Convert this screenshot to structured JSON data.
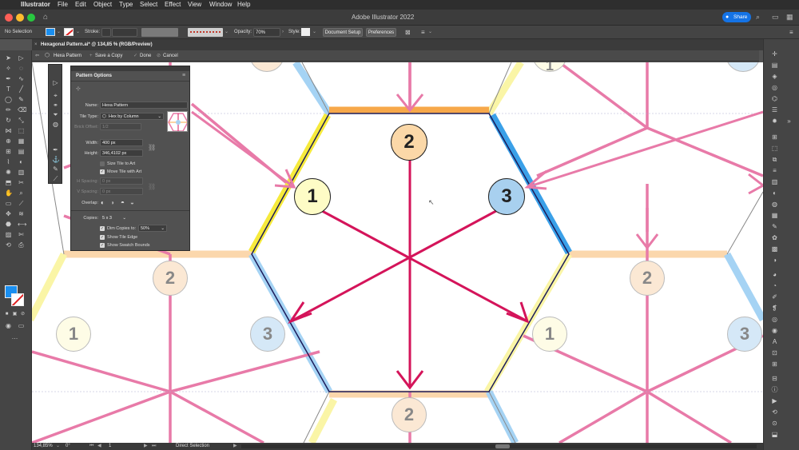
{
  "menubar": {
    "app": "Illustrator",
    "items": [
      "File",
      "Edit",
      "Object",
      "Type",
      "Select",
      "Effect",
      "View",
      "Window",
      "Help"
    ],
    "clock": ""
  },
  "titlebar": {
    "title": "Adobe Illustrator 2022",
    "share_label": "Share"
  },
  "control": {
    "selection": "No Selection",
    "stroke_label": "Stroke:",
    "opacity_label": "Opacity:",
    "opacity_value": "70%",
    "style_label": "Style:",
    "doc_setup": "Document Setup",
    "preferences": "Preferences"
  },
  "doctab": {
    "title": "Hexagonal Pattern.ai* @ 134,85 % (RGB/Preview)"
  },
  "patternbar": {
    "name": "Hexa Pattern",
    "save_copy": "Save a Copy",
    "done": "Done",
    "cancel": "Cancel"
  },
  "panel": {
    "title": "Pattern Options",
    "name_label": "Name:",
    "name_value": "Hexa Pattern",
    "tile_type_label": "Tile Type:",
    "tile_type_value": "Hex by Column",
    "brick_offset_label": "Brick Offset:",
    "brick_offset_value": "1/2",
    "width_label": "Width:",
    "width_value": "400 px",
    "height_label": "Height:",
    "height_value": "346,4102 px",
    "size_tile": "Size Tile to Art",
    "move_tile": "Move Tile with Art",
    "hspacing_label": "H Spacing:",
    "hspacing_value": "0 px",
    "vspacing_label": "V Spacing:",
    "vspacing_value": "0 px",
    "overlap_label": "Overlap:",
    "copies_label": "Copies:",
    "copies_value": "5 x 3",
    "dim_copies": "Dim Copies to:",
    "dim_value": "50%",
    "show_tile_edge": "Show Tile Edge",
    "show_swatch_bounds": "Show Swatch Bounds"
  },
  "status": {
    "zoom": "134,85%",
    "rotation": "0°",
    "artboard": "1",
    "tool": "Direct Selection"
  },
  "canvas": {
    "labels": [
      {
        "num": "2",
        "fill": "#fbd8a8",
        "dim": false
      },
      {
        "num": "1",
        "fill": "#fefcc6",
        "dim": false
      },
      {
        "num": "3",
        "fill": "#a8d0ef",
        "dim": false
      },
      {
        "num": "2",
        "fill": "#fbe8d4",
        "dim": true
      },
      {
        "num": "2",
        "fill": "#fbe8d4",
        "dim": true
      },
      {
        "num": "1",
        "fill": "#fefce6",
        "dim": true
      },
      {
        "num": "3",
        "fill": "#d5e8f7",
        "dim": true
      },
      {
        "num": "1",
        "fill": "#fefce6",
        "dim": true
      },
      {
        "num": "3",
        "fill": "#d5e8f7",
        "dim": true
      },
      {
        "num": "2",
        "fill": "#fbe8d4",
        "dim": true
      },
      {
        "num": "1",
        "fill": "#fefce6",
        "dim": true
      },
      {
        "num": "2",
        "fill": "#fbe8d4",
        "dim": true
      }
    ],
    "colors": {
      "magenta": "#d4145a",
      "pink": "#e87aa8",
      "orange": "#f7a84a",
      "yellow": "#f6ea3c",
      "blue": "#3aa0e8",
      "edge": "#1c1c5a"
    }
  }
}
